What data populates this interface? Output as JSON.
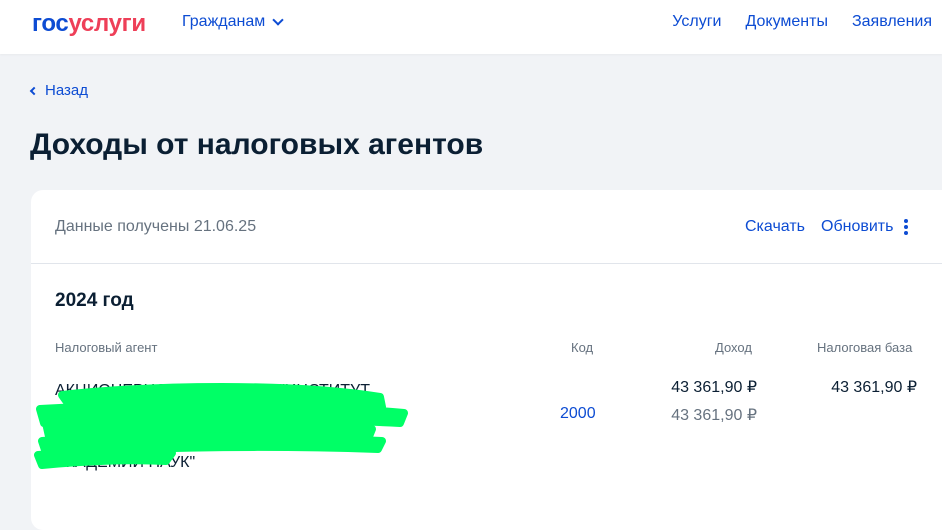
{
  "header": {
    "logo_part1": "гос",
    "logo_part2": "услуги",
    "nav_dropdown": "Гражданам",
    "links": [
      "Услуги",
      "Документы",
      "Заявления"
    ]
  },
  "back_label": "Назад",
  "page_title": "Доходы от налоговых агентов",
  "card": {
    "received": "Данные получены 21.06.25",
    "download": "Скачать",
    "refresh": "Обновить",
    "year": "2024 год",
    "columns": {
      "agent": "Налоговый агент",
      "code": "Код",
      "income": "Доход",
      "base": "Налоговая база"
    },
    "rows": [
      {
        "agent_line1": "АКЦИОНЕРНОЕ ОБЩЕСТВО \"ИНСТИТУТ",
        "agent_line3": "РОССИЙСКОЙ",
        "agent_line4": "АКАДЕМИИ НАУК\"",
        "total_income": "43 361,90 ₽",
        "tax_base": "43 361,90 ₽",
        "code": "2000",
        "code_income": "43 361,90 ₽"
      }
    ]
  },
  "colors": {
    "accent": "#0d4cd3",
    "logo_red": "#ee3f58",
    "text": "#0b1f33",
    "muted": "#66727f",
    "redaction": "#00ff66"
  },
  "icons": {
    "dropdown": "chevron-down-icon",
    "back": "chevron-left-icon",
    "more": "kebab-menu-icon"
  }
}
